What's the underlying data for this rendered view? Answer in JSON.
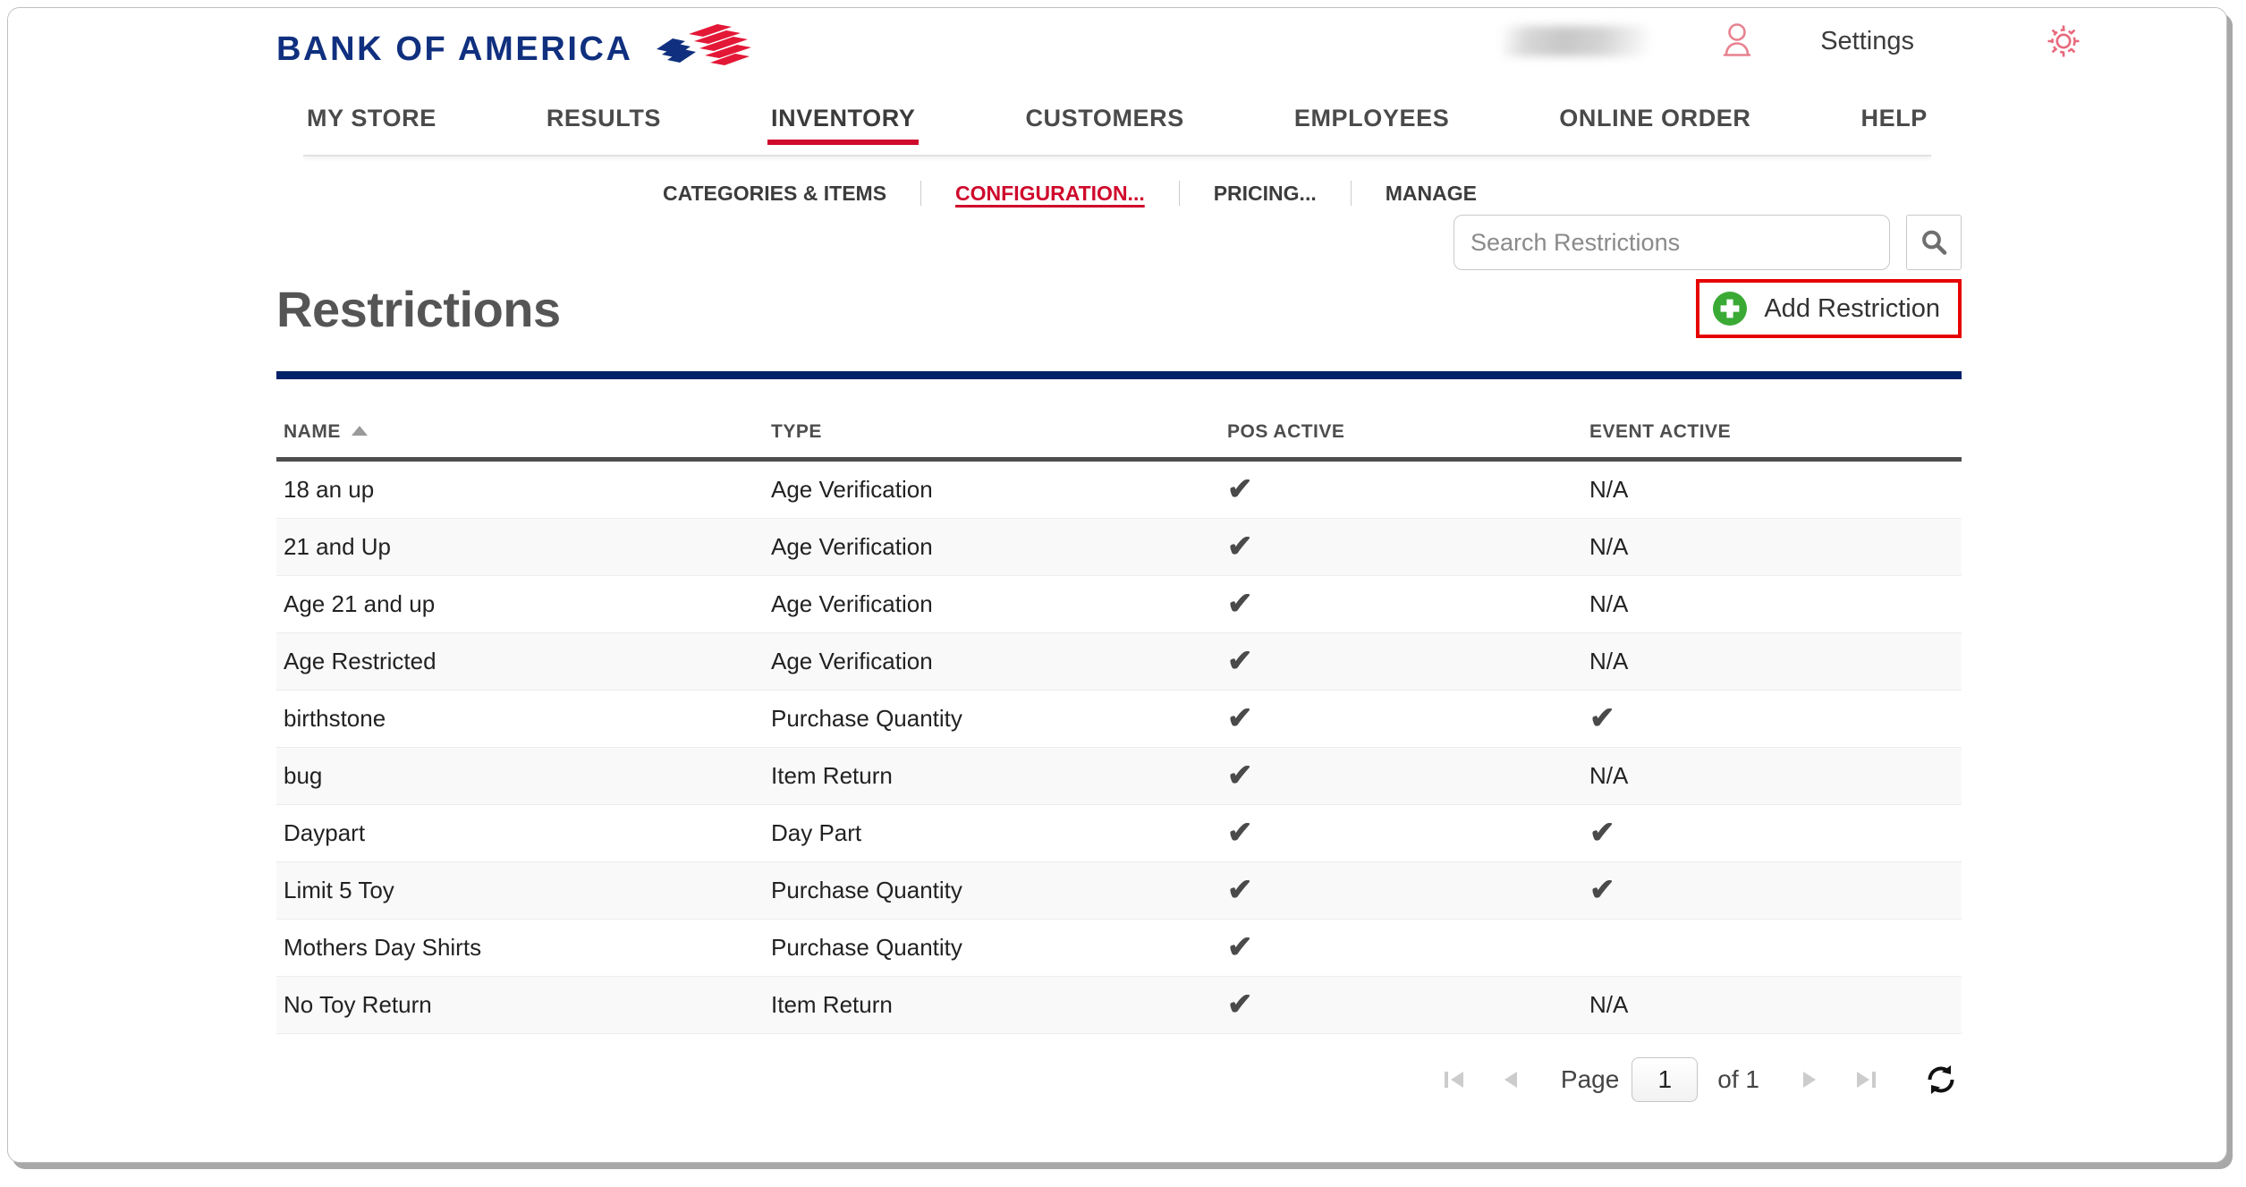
{
  "brand": {
    "logo_text": "BANK OF AMERICA",
    "logo_icon": "bank-of-america-flag-logo",
    "colors": {
      "navy": "#10307f",
      "red": "#cf0a2c",
      "rule_navy": "#012169",
      "annotation_red": "#e60000",
      "plus_green": "#3aaa35"
    }
  },
  "header": {
    "user_name_blurred": "",
    "person_icon": "person-icon",
    "settings_label": "Settings",
    "gear_icon": "gear-icon"
  },
  "primary_nav": {
    "items": [
      {
        "label": "MY STORE",
        "active": false
      },
      {
        "label": "RESULTS",
        "active": false
      },
      {
        "label": "INVENTORY",
        "active": true
      },
      {
        "label": "CUSTOMERS",
        "active": false
      },
      {
        "label": "EMPLOYEES",
        "active": false
      },
      {
        "label": "ONLINE ORDER",
        "active": false
      },
      {
        "label": "HELP",
        "active": false
      }
    ]
  },
  "secondary_nav": {
    "items": [
      {
        "label": "CATEGORIES & ITEMS",
        "active": false
      },
      {
        "label": "CONFIGURATION...",
        "active": true
      },
      {
        "label": "PRICING...",
        "active": false
      },
      {
        "label": "MANAGE",
        "active": false
      }
    ]
  },
  "search": {
    "placeholder": "Search Restrictions",
    "value": "",
    "button_icon": "search-icon"
  },
  "page": {
    "title": "Restrictions",
    "add_button": {
      "label": "Add Restriction",
      "icon": "plus-circle-icon"
    }
  },
  "table": {
    "columns": [
      {
        "key": "name",
        "label": "NAME",
        "sort": "asc"
      },
      {
        "key": "type",
        "label": "TYPE",
        "sort": null
      },
      {
        "key": "pos_active",
        "label": "POS ACTIVE",
        "sort": null
      },
      {
        "key": "event_active",
        "label": "EVENT ACTIVE",
        "sort": null
      }
    ],
    "check_glyph": "✔",
    "na_text": "N/A",
    "rows": [
      {
        "name": "18 an up",
        "type": "Age Verification",
        "pos_active": "check",
        "event_active": "N/A"
      },
      {
        "name": "21 and Up",
        "type": "Age Verification",
        "pos_active": "check",
        "event_active": "N/A"
      },
      {
        "name": "Age 21 and up",
        "type": "Age Verification",
        "pos_active": "check",
        "event_active": "N/A"
      },
      {
        "name": "Age Restricted",
        "type": "Age Verification",
        "pos_active": "check",
        "event_active": "N/A"
      },
      {
        "name": "birthstone",
        "type": "Purchase Quantity",
        "pos_active": "check",
        "event_active": "check"
      },
      {
        "name": "bug",
        "type": "Item Return",
        "pos_active": "check",
        "event_active": "N/A"
      },
      {
        "name": "Daypart",
        "type": "Day Part",
        "pos_active": "check",
        "event_active": "check"
      },
      {
        "name": "Limit 5 Toy",
        "type": "Purchase Quantity",
        "pos_active": "check",
        "event_active": "check"
      },
      {
        "name": "Mothers Day Shirts",
        "type": "Purchase Quantity",
        "pos_active": "check",
        "event_active": ""
      },
      {
        "name": "No Toy Return",
        "type": "Item Return",
        "pos_active": "check",
        "event_active": "N/A"
      }
    ]
  },
  "pagination": {
    "first_icon": "first-page-icon",
    "prev_icon": "previous-page-icon",
    "page_label": "Page",
    "page_value": "1",
    "of_label": "of 1",
    "next_icon": "next-page-icon",
    "last_icon": "last-page-icon",
    "refresh_icon": "refresh-icon"
  }
}
